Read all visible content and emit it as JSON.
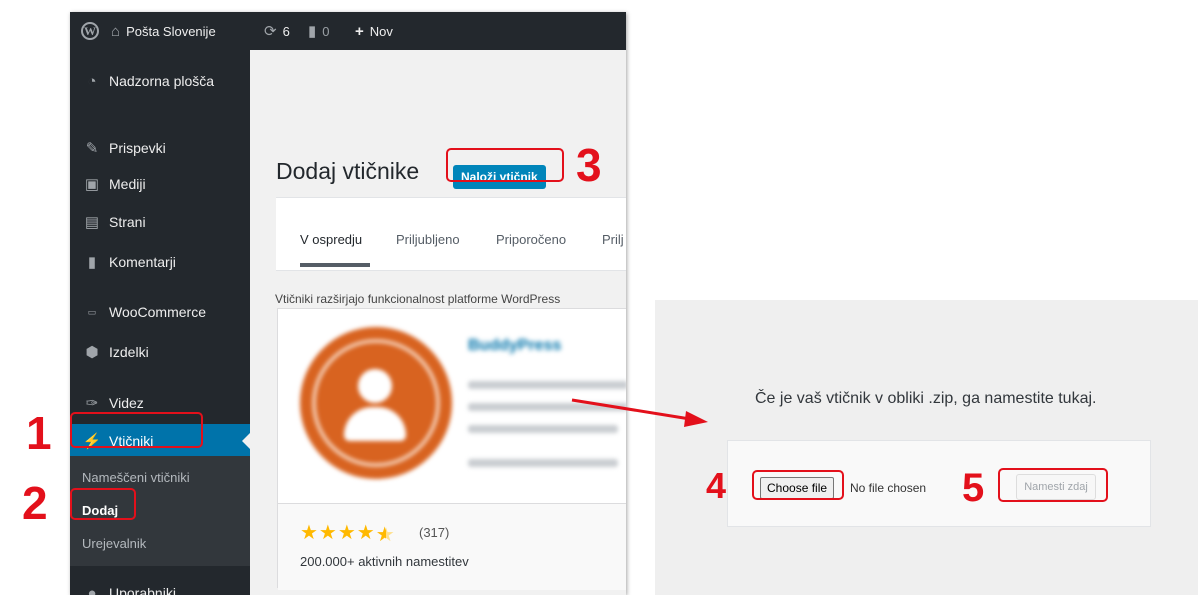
{
  "admin_bar": {
    "site_name": "Pošta Slovenije",
    "updates_count": "6",
    "comments_count": "0",
    "new_label": "Nov"
  },
  "sidebar": {
    "items": [
      {
        "label": "Nadzorna plošča",
        "icon": "dashboard-icon"
      },
      {
        "label": "Prispevki",
        "icon": "pin-icon"
      },
      {
        "label": "Mediji",
        "icon": "media-icon"
      },
      {
        "label": "Strani",
        "icon": "page-icon"
      },
      {
        "label": "Komentarji",
        "icon": "comment-icon"
      },
      {
        "label": "WooCommerce",
        "icon": "woo-icon"
      },
      {
        "label": "Izdelki",
        "icon": "box-icon"
      },
      {
        "label": "Videz",
        "icon": "brush-icon"
      },
      {
        "label": "Vtičniki",
        "icon": "plug-icon"
      },
      {
        "label": "Uporabniki",
        "icon": "user-icon"
      }
    ],
    "submenu": [
      "Nameščeni vtičniki",
      "Dodaj",
      "Urejevalnik"
    ]
  },
  "main": {
    "title": "Dodaj vtičnike",
    "upload_button": "Naloži vtičnik",
    "tabs": [
      "V ospredju",
      "Priljubljeno",
      "Priporočeno",
      "Prilj"
    ],
    "intro": "Vtičniki razširjajo funkcionalnost platforme WordPress"
  },
  "plugin_card": {
    "name": "BuddyPress",
    "rating": 4.5,
    "rating_count": "(317)",
    "installs": "200.000+ aktivnih namestitev"
  },
  "upload": {
    "hint": "Če je vaš vtičnik v obliki .zip, ga namestite tukaj.",
    "choose_file_label": "Choose file",
    "no_file_text": "No file chosen",
    "install_button": "Namesti zdaj"
  },
  "annotations": [
    "1",
    "2",
    "3",
    "4",
    "5"
  ],
  "colors": {
    "admin_dark": "#23282d",
    "wp_blue": "#0073aa",
    "highlight_red": "#e3101b"
  }
}
